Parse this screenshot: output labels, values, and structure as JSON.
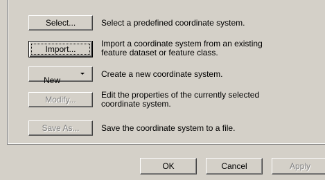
{
  "actions": [
    {
      "id": "select",
      "button_label": "Select...",
      "description_lines": [
        "Select a predefined coordinate system."
      ],
      "enabled": true
    },
    {
      "id": "import",
      "button_label": "Import...",
      "description_lines": [
        "Import a coordinate system from an existing",
        "feature dataset or feature class."
      ],
      "enabled": true
    },
    {
      "id": "new",
      "button_label": "New",
      "description_lines": [
        "Create a new coordinate system."
      ],
      "enabled": true
    },
    {
      "id": "modify",
      "button_label": "Modify...",
      "description_lines": [
        "Edit the properties of the currently selected",
        "coordinate system."
      ],
      "enabled": false
    },
    {
      "id": "save_as",
      "button_label": "Save As...",
      "description_lines": [
        "Save the coordinate system to a file."
      ],
      "enabled": false
    }
  ],
  "footer": {
    "ok_label": "OK",
    "cancel_label": "Cancel",
    "apply_label": "Apply",
    "apply_enabled": false
  },
  "icons": {
    "new_dropdown": "chevron-down-icon"
  }
}
